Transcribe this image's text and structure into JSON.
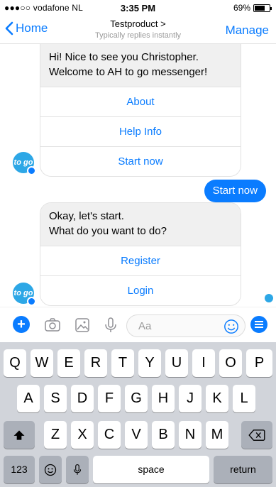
{
  "status_bar": {
    "carrier": "●●●○○ vodafone NL",
    "time": "3:35 PM",
    "battery": "69%",
    "battery_level": 0.69
  },
  "nav": {
    "back_label": "Home",
    "title": "Testproduct >",
    "subtitle": "Typically replies instantly",
    "action_label": "Manage"
  },
  "messages": {
    "bot_card_1": {
      "text_line1": "Hi! Nice to see you Christopher.",
      "text_line2": "Welcome to AH to go messenger!",
      "buttons": [
        "About",
        "Help Info",
        "Start now"
      ]
    },
    "user_reply": "Start now",
    "bot_card_2": {
      "text_line1": "Okay, let's start.",
      "text_line2": "What do you want to do?",
      "buttons": [
        "Register",
        "Login"
      ]
    },
    "avatar_label": "to go"
  },
  "composer": {
    "placeholder": "Aa",
    "icons": [
      "plus-icon",
      "camera-icon",
      "gallery-icon",
      "microphone-icon",
      "emoji-icon",
      "menu-icon"
    ]
  },
  "keyboard": {
    "row1": [
      "Q",
      "W",
      "E",
      "R",
      "T",
      "Y",
      "U",
      "I",
      "O",
      "P"
    ],
    "row2": [
      "A",
      "S",
      "D",
      "F",
      "G",
      "H",
      "J",
      "K",
      "L"
    ],
    "row3": [
      "Z",
      "X",
      "C",
      "V",
      "B",
      "N",
      "M"
    ],
    "numbers_key": "123",
    "space_key": "space",
    "return_key": "return"
  },
  "colors": {
    "accent": "#0a7cff",
    "avatar": "#2da7e6",
    "incoming_bubble": "#f0f0f0",
    "keyboard_bg": "#d1d4da"
  }
}
